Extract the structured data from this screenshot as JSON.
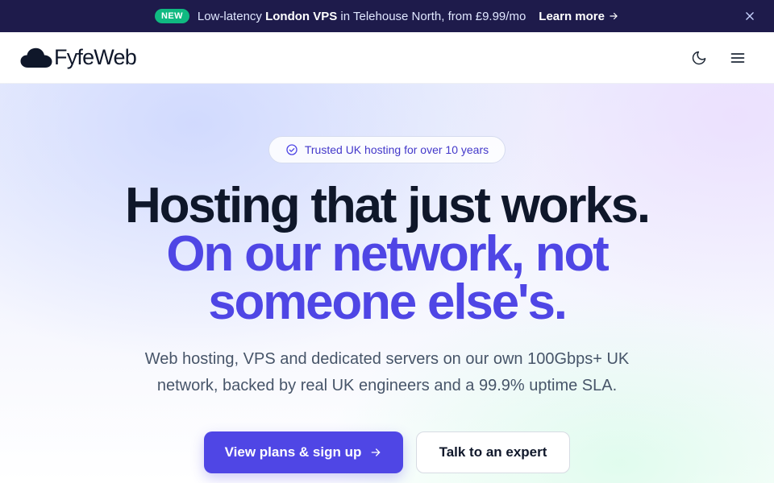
{
  "announcement": {
    "badge": "NEW",
    "text_before": "Low-latency ",
    "text_bold": "London VPS",
    "text_after": " in Telehouse North, from £9.99/mo",
    "link_label": "Learn more",
    "link_icon": "arrow-right-icon",
    "close_icon": "close-icon"
  },
  "header": {
    "logo_text": "FyfeWeb",
    "logo_icon": "cloud-icon",
    "theme_toggle_icon": "moon-icon",
    "menu_icon": "hamburger-menu-icon"
  },
  "hero": {
    "trust_pill": "Trusted UK hosting for over 10 years",
    "trust_icon": "check-circle-icon",
    "headline_line1": "Hosting that just works.",
    "headline_accent_line1": "On our network, not",
    "headline_accent_line2": "someone else's.",
    "subtext_line1": "Web hosting, VPS and dedicated servers on our own 100Gbps+ UK",
    "subtext_line2": "network, backed by real UK engineers and a 99.9% uptime SLA.",
    "primary_cta": "View plans & sign up",
    "secondary_cta": "Talk to an expert"
  },
  "colors": {
    "announcement_bg": "#1e1b4b",
    "badge_green": "#10b981",
    "accent": "#4f46e5",
    "heading": "#0f172a",
    "body_text": "#475569"
  }
}
